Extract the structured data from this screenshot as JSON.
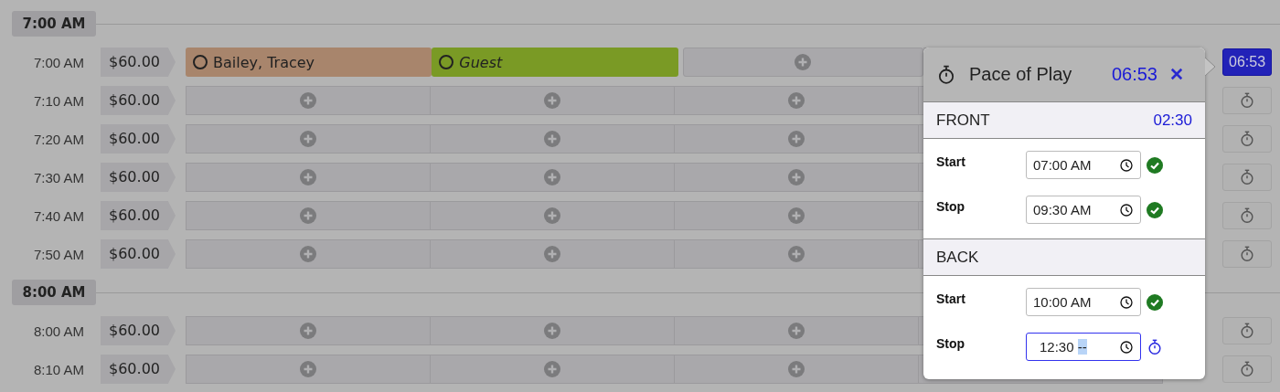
{
  "schedule": [
    {
      "hour": "7:00 AM",
      "rows": [
        {
          "time": "7:00 AM",
          "price": "$60.00",
          "slots": [
            {
              "kind": "booking",
              "name": "Bailey, Tracey",
              "color": "#a8856c"
            },
            {
              "kind": "guest",
              "name": "Guest",
              "color": "#7a9a25"
            },
            {
              "kind": "open"
            },
            {
              "kind": "covered"
            }
          ],
          "timer": {
            "kind": "running",
            "label": "06:53",
            "selected": true
          }
        },
        {
          "time": "7:10 AM",
          "price": "$60.00",
          "slots": [
            {
              "kind": "open"
            },
            {
              "kind": "open"
            },
            {
              "kind": "open"
            },
            {
              "kind": "covered"
            }
          ],
          "timer": {
            "kind": "idle",
            "selected": false
          }
        },
        {
          "time": "7:20 AM",
          "price": "$60.00",
          "slots": [
            {
              "kind": "open"
            },
            {
              "kind": "open"
            },
            {
              "kind": "open"
            },
            {
              "kind": "covered"
            }
          ],
          "timer": {
            "kind": "idle",
            "selected": false
          }
        },
        {
          "time": "7:30 AM",
          "price": "$60.00",
          "slots": [
            {
              "kind": "open"
            },
            {
              "kind": "open"
            },
            {
              "kind": "open"
            },
            {
              "kind": "covered"
            }
          ],
          "timer": {
            "kind": "idle",
            "selected": false
          }
        },
        {
          "time": "7:40 AM",
          "price": "$60.00",
          "slots": [
            {
              "kind": "open"
            },
            {
              "kind": "open"
            },
            {
              "kind": "open"
            },
            {
              "kind": "covered"
            }
          ],
          "timer": {
            "kind": "idle",
            "selected": false
          }
        },
        {
          "time": "7:50 AM",
          "price": "$60.00",
          "slots": [
            {
              "kind": "open"
            },
            {
              "kind": "open"
            },
            {
              "kind": "open"
            },
            {
              "kind": "covered"
            }
          ],
          "timer": {
            "kind": "idle",
            "selected": false
          }
        }
      ]
    },
    {
      "hour": "8:00 AM",
      "rows": [
        {
          "time": "8:00 AM",
          "price": "$60.00",
          "slots": [
            {
              "kind": "open"
            },
            {
              "kind": "open"
            },
            {
              "kind": "open"
            },
            {
              "kind": "covered"
            }
          ],
          "timer": {
            "kind": "idle",
            "selected": false
          }
        },
        {
          "time": "8:10 AM",
          "price": "$60.00",
          "slots": [
            {
              "kind": "open"
            },
            {
              "kind": "open"
            },
            {
              "kind": "open"
            },
            {
              "kind": "covered"
            }
          ],
          "timer": {
            "kind": "idle",
            "selected": false
          }
        }
      ]
    }
  ],
  "pace_of_play": {
    "title": "Pace of Play",
    "elapsed": "06:53",
    "sections": [
      {
        "name": "FRONT",
        "total": "02:30",
        "fields": [
          {
            "label": "Start",
            "value": "07:00 AM",
            "kind": "done",
            "focused": false
          },
          {
            "label": "Stop",
            "value": "09:30 AM",
            "kind": "done",
            "focused": false
          }
        ]
      },
      {
        "name": "BACK",
        "fields": [
          {
            "label": "Start",
            "value": "10:00 AM",
            "kind": "done",
            "focused": false
          },
          {
            "label": "Stop",
            "value": "12:30",
            "pending": "--",
            "kind": "timing",
            "focused": true
          }
        ]
      }
    ]
  }
}
